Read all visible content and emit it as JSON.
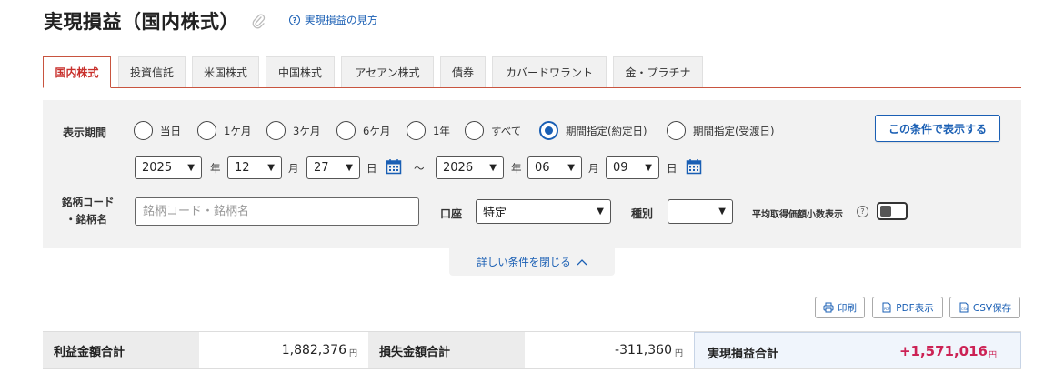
{
  "page": {
    "title": "実現損益（国内株式）",
    "help_link": "実現損益の見方"
  },
  "tabs": [
    {
      "label": "国内株式",
      "active": true
    },
    {
      "label": "投資信託",
      "active": false
    },
    {
      "label": "米国株式",
      "active": false
    },
    {
      "label": "中国株式",
      "active": false
    },
    {
      "label": "アセアン株式",
      "active": false
    },
    {
      "label": "債券",
      "active": false
    },
    {
      "label": "カバードワラント",
      "active": false
    },
    {
      "label": "金・プラチナ",
      "active": false
    }
  ],
  "filter": {
    "period_label": "表示期間",
    "period_options": [
      {
        "label": "当日",
        "selected": false
      },
      {
        "label": "1ケ月",
        "selected": false
      },
      {
        "label": "3ケ月",
        "selected": false
      },
      {
        "label": "6ケ月",
        "selected": false
      },
      {
        "label": "1年",
        "selected": false
      },
      {
        "label": "すべて",
        "selected": false
      },
      {
        "label": "期間指定(約定日)",
        "selected": true
      },
      {
        "label": "期間指定(受渡日)",
        "selected": false
      }
    ],
    "submit_label": "この条件で表示する",
    "from": {
      "year": "2025",
      "month": "12",
      "day": "27"
    },
    "to": {
      "year": "2026",
      "month": "06",
      "day": "09"
    },
    "unit_year": "年",
    "unit_month": "月",
    "unit_day": "日",
    "range_sep": "～",
    "code_label_line1": "銘柄コード",
    "code_label_line2": "・銘柄名",
    "code_placeholder": "銘柄コード・銘柄名",
    "account_label": "口座",
    "account_value": "特定",
    "type_label": "種別",
    "type_value": "",
    "avg_price_label": "平均取得価額小数表示",
    "avg_price_toggle_on": false,
    "collapse_label": "詳しい条件を閉じる"
  },
  "actions": {
    "print": "印刷",
    "pdf": "PDF表示",
    "csv": "CSV保存"
  },
  "summary": {
    "profit_label": "利益金額合計",
    "profit_value": "1,882,376",
    "loss_label": "損失金額合計",
    "loss_value": "-311,360",
    "total_label": "実現損益合計",
    "total_value": "+1,571,016",
    "yen": "円"
  },
  "colors": {
    "accent_red": "#c8302c",
    "link_blue": "#1a5fb4",
    "total_pink": "#cc2255"
  }
}
